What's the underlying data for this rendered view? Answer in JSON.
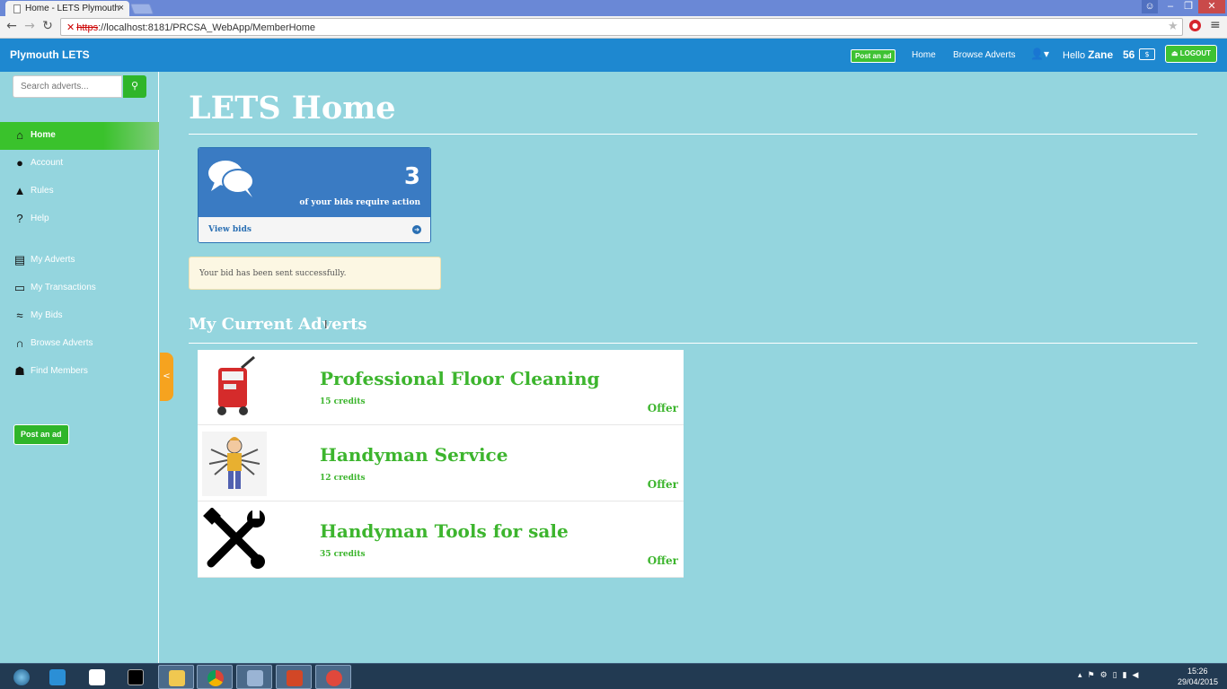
{
  "browser": {
    "tab_title": "Home - LETS Plymouth",
    "url_protocol": "https",
    "url_rest": "://localhost:8181/PRCSA_WebApp/MemberHome"
  },
  "navbar": {
    "brand": "Plymouth LETS",
    "post_ad": "Post an ad",
    "home": "Home",
    "browse": "Browse Adverts",
    "hello": "Hello",
    "username": "Zane",
    "credits": "56",
    "logout": "LOGOUT"
  },
  "sidebar": {
    "search_placeholder": "Search adverts...",
    "items": [
      {
        "label": "Home",
        "icon": "home-icon"
      },
      {
        "label": "Account",
        "icon": "user-circle-icon"
      },
      {
        "label": "Rules",
        "icon": "warning-icon"
      },
      {
        "label": "Help",
        "icon": "question-icon"
      },
      {
        "label": "My Adverts",
        "icon": "documents-icon"
      },
      {
        "label": "My Transactions",
        "icon": "money-icon"
      },
      {
        "label": "My Bids",
        "icon": "handshake-icon"
      },
      {
        "label": "Browse Adverts",
        "icon": "headset-icon"
      },
      {
        "label": "Find Members",
        "icon": "group-icon"
      }
    ],
    "post_ad": "Post an ad",
    "collapse": "<"
  },
  "main": {
    "title": "LETS Home",
    "bids": {
      "count": "3",
      "text": "of your bids require action",
      "link": "View bids"
    },
    "alert": "Your bid has been sent successfully.",
    "section_title": "My Current Adverts",
    "adverts": [
      {
        "title": "Professional Floor Cleaning",
        "credits": "15 credits",
        "type": "Offer"
      },
      {
        "title": "Handyman Service",
        "credits": "12 credits",
        "type": "Offer"
      },
      {
        "title": "Handyman Tools for sale",
        "credits": "35 credits",
        "type": "Offer"
      }
    ]
  },
  "taskbar": {
    "time": "15:26",
    "date": "29/04/2015"
  },
  "colors": {
    "navbar": "#1e88d0",
    "background": "#94d5de",
    "accent_green": "#3db52e",
    "panel_blue": "#3a7bc3",
    "collapse_orange": "#f6a31f"
  }
}
